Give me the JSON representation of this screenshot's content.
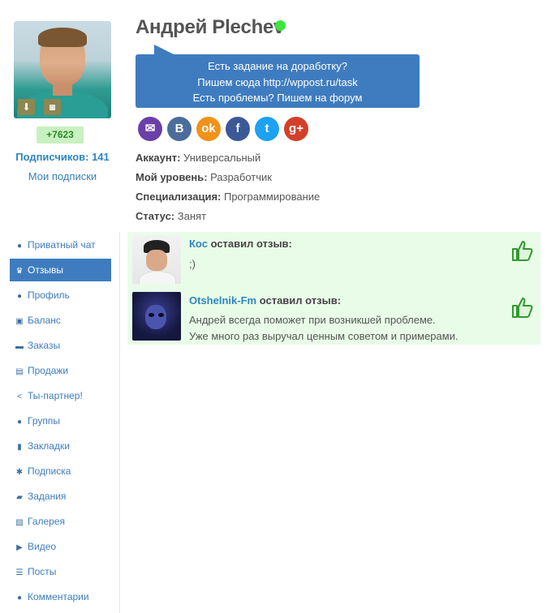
{
  "profile": {
    "name": "Андрей Plechev",
    "status_color": "#3ee63e",
    "rating": "+7623",
    "subscribers": "Подписчиков: 141",
    "my_subscriptions": "Мои подписки"
  },
  "notice": {
    "line1": "Есть задание на доработку?",
    "line2": "Пишем сюда http://wppost.ru/task",
    "line3": "Есть проблемы? Пишем на форум"
  },
  "social": [
    {
      "name": "email",
      "glyph": "✉",
      "color": "#6b3fa8"
    },
    {
      "name": "vk",
      "glyph": "B",
      "color": "#4a6d9c"
    },
    {
      "name": "odnoklassniki",
      "glyph": "ok",
      "color": "#f0921a"
    },
    {
      "name": "facebook",
      "glyph": "f",
      "color": "#3b5998"
    },
    {
      "name": "twitter",
      "glyph": "t",
      "color": "#1da1f2"
    },
    {
      "name": "google-plus",
      "glyph": "g+",
      "color": "#d3402a"
    }
  ],
  "info": {
    "account_label": "Аккаунт:",
    "account_value": "Универсальный",
    "level_label": "Мой уровень:",
    "level_value": "Разработчик",
    "spec_label": "Специализация:",
    "spec_value": "Программирование",
    "status_label": "Статус:",
    "status_value": "Занят"
  },
  "menu": [
    {
      "label": "Приватный чат",
      "icon": "chat-icon",
      "glyph": "●"
    },
    {
      "label": "Отзывы",
      "icon": "trophy-icon",
      "glyph": "♛",
      "active": true
    },
    {
      "label": "Профиль",
      "icon": "user-icon",
      "glyph": "●"
    },
    {
      "label": "Баланс",
      "icon": "money-icon",
      "glyph": "▣"
    },
    {
      "label": "Заказы",
      "icon": "cart-icon",
      "glyph": "▬"
    },
    {
      "label": "Продажи",
      "icon": "list-icon",
      "glyph": "▤"
    },
    {
      "label": "Ты-партнер!",
      "icon": "share-icon",
      "glyph": "<"
    },
    {
      "label": "Группы",
      "icon": "users-icon",
      "glyph": "●"
    },
    {
      "label": "Закладки",
      "icon": "bookmark-icon",
      "glyph": "▮"
    },
    {
      "label": "Подписка",
      "icon": "gear-icon",
      "glyph": "✱"
    },
    {
      "label": "Задания",
      "icon": "book-icon",
      "glyph": "▰"
    },
    {
      "label": "Галерея",
      "icon": "image-icon",
      "glyph": "▨"
    },
    {
      "label": "Видео",
      "icon": "video-icon",
      "glyph": "▶"
    },
    {
      "label": "Посты",
      "icon": "posts-icon",
      "glyph": "☰"
    },
    {
      "label": "Комментарии",
      "icon": "comment-icon",
      "glyph": "●"
    }
  ],
  "reviews": [
    {
      "author": "Кос",
      "suffix": "оставил отзыв:",
      "text1": ";)",
      "text2": ""
    },
    {
      "author": "Otshelnik-Fm",
      "suffix": "оставил отзыв:",
      "text1": "Андрей всегда поможет при возникшей проблеме.",
      "text2": "Уже много раз выручал ценным советом и примерами."
    }
  ],
  "colors": {
    "accent": "#3f7cbf",
    "link": "#2e86c1",
    "reviews_bg": "#e9fce8",
    "thumb": "#2f9a2f"
  }
}
